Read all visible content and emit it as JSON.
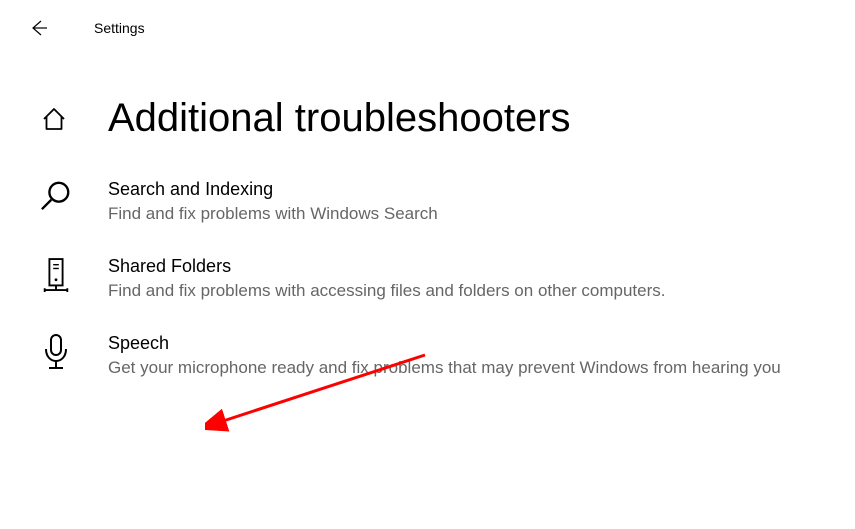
{
  "header": {
    "title": "Settings"
  },
  "page": {
    "title": "Additional troubleshooters"
  },
  "troubleshooters": [
    {
      "title": "Search and Indexing",
      "description": "Find and fix problems with Windows Search"
    },
    {
      "title": "Shared Folders",
      "description": "Find and fix problems with accessing files and folders on other computers."
    },
    {
      "title": "Speech",
      "description": "Get your microphone ready and fix problems that may prevent Windows from hearing you"
    }
  ]
}
